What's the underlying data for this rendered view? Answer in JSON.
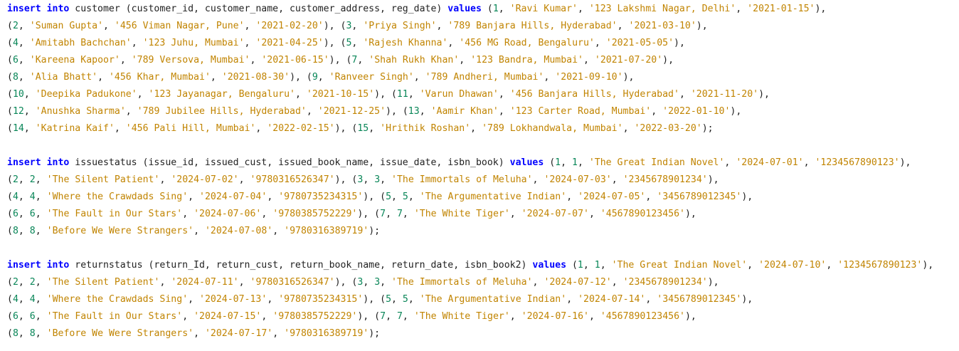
{
  "colors": {
    "background": "#ffffff",
    "keyword": "#0000ff",
    "number": "#098658",
    "string": "#c18401",
    "text": "#1f1f1f"
  },
  "lines": [
    [
      {
        "t": "kw",
        "v": "insert into"
      },
      {
        "t": "plain",
        "v": " customer (customer_id, customer_name, customer_address, reg_date) "
      },
      {
        "t": "kw",
        "v": "values"
      },
      {
        "t": "plain",
        "v": " ("
      },
      {
        "t": "num",
        "v": "1"
      },
      {
        "t": "plain",
        "v": ", "
      },
      {
        "t": "str",
        "v": "'Ravi Kumar'"
      },
      {
        "t": "plain",
        "v": ", "
      },
      {
        "t": "str",
        "v": "'123 Lakshmi Nagar, Delhi'"
      },
      {
        "t": "plain",
        "v": ", "
      },
      {
        "t": "str",
        "v": "'2021-01-15'"
      },
      {
        "t": "plain",
        "v": "),"
      }
    ],
    [
      {
        "t": "plain",
        "v": "("
      },
      {
        "t": "num",
        "v": "2"
      },
      {
        "t": "plain",
        "v": ", "
      },
      {
        "t": "str",
        "v": "'Suman Gupta'"
      },
      {
        "t": "plain",
        "v": ", "
      },
      {
        "t": "str",
        "v": "'456 Viman Nagar, Pune'"
      },
      {
        "t": "plain",
        "v": ", "
      },
      {
        "t": "str",
        "v": "'2021-02-20'"
      },
      {
        "t": "plain",
        "v": "), ("
      },
      {
        "t": "num",
        "v": "3"
      },
      {
        "t": "plain",
        "v": ", "
      },
      {
        "t": "str",
        "v": "'Priya Singh'"
      },
      {
        "t": "plain",
        "v": ", "
      },
      {
        "t": "str",
        "v": "'789 Banjara Hills, Hyderabad'"
      },
      {
        "t": "plain",
        "v": ", "
      },
      {
        "t": "str",
        "v": "'2021-03-10'"
      },
      {
        "t": "plain",
        "v": "),"
      }
    ],
    [
      {
        "t": "plain",
        "v": "("
      },
      {
        "t": "num",
        "v": "4"
      },
      {
        "t": "plain",
        "v": ", "
      },
      {
        "t": "str",
        "v": "'Amitabh Bachchan'"
      },
      {
        "t": "plain",
        "v": ", "
      },
      {
        "t": "str",
        "v": "'123 Juhu, Mumbai'"
      },
      {
        "t": "plain",
        "v": ", "
      },
      {
        "t": "str",
        "v": "'2021-04-25'"
      },
      {
        "t": "plain",
        "v": "), ("
      },
      {
        "t": "num",
        "v": "5"
      },
      {
        "t": "plain",
        "v": ", "
      },
      {
        "t": "str",
        "v": "'Rajesh Khanna'"
      },
      {
        "t": "plain",
        "v": ", "
      },
      {
        "t": "str",
        "v": "'456 MG Road, Bengaluru'"
      },
      {
        "t": "plain",
        "v": ", "
      },
      {
        "t": "str",
        "v": "'2021-05-05'"
      },
      {
        "t": "plain",
        "v": "),"
      }
    ],
    [
      {
        "t": "plain",
        "v": "("
      },
      {
        "t": "num",
        "v": "6"
      },
      {
        "t": "plain",
        "v": ", "
      },
      {
        "t": "str",
        "v": "'Kareena Kapoor'"
      },
      {
        "t": "plain",
        "v": ", "
      },
      {
        "t": "str",
        "v": "'789 Versova, Mumbai'"
      },
      {
        "t": "plain",
        "v": ", "
      },
      {
        "t": "str",
        "v": "'2021-06-15'"
      },
      {
        "t": "plain",
        "v": "), ("
      },
      {
        "t": "num",
        "v": "7"
      },
      {
        "t": "plain",
        "v": ", "
      },
      {
        "t": "str",
        "v": "'Shah Rukh Khan'"
      },
      {
        "t": "plain",
        "v": ", "
      },
      {
        "t": "str",
        "v": "'123 Bandra, Mumbai'"
      },
      {
        "t": "plain",
        "v": ", "
      },
      {
        "t": "str",
        "v": "'2021-07-20'"
      },
      {
        "t": "plain",
        "v": "),"
      }
    ],
    [
      {
        "t": "plain",
        "v": "("
      },
      {
        "t": "num",
        "v": "8"
      },
      {
        "t": "plain",
        "v": ", "
      },
      {
        "t": "str",
        "v": "'Alia Bhatt'"
      },
      {
        "t": "plain",
        "v": ", "
      },
      {
        "t": "str",
        "v": "'456 Khar, Mumbai'"
      },
      {
        "t": "plain",
        "v": ", "
      },
      {
        "t": "str",
        "v": "'2021-08-30'"
      },
      {
        "t": "plain",
        "v": "), ("
      },
      {
        "t": "num",
        "v": "9"
      },
      {
        "t": "plain",
        "v": ", "
      },
      {
        "t": "str",
        "v": "'Ranveer Singh'"
      },
      {
        "t": "plain",
        "v": ", "
      },
      {
        "t": "str",
        "v": "'789 Andheri, Mumbai'"
      },
      {
        "t": "plain",
        "v": ", "
      },
      {
        "t": "str",
        "v": "'2021-09-10'"
      },
      {
        "t": "plain",
        "v": "),"
      }
    ],
    [
      {
        "t": "plain",
        "v": "("
      },
      {
        "t": "num",
        "v": "10"
      },
      {
        "t": "plain",
        "v": ", "
      },
      {
        "t": "str",
        "v": "'Deepika Padukone'"
      },
      {
        "t": "plain",
        "v": ", "
      },
      {
        "t": "str",
        "v": "'123 Jayanagar, Bengaluru'"
      },
      {
        "t": "plain",
        "v": ", "
      },
      {
        "t": "str",
        "v": "'2021-10-15'"
      },
      {
        "t": "plain",
        "v": "), ("
      },
      {
        "t": "num",
        "v": "11"
      },
      {
        "t": "plain",
        "v": ", "
      },
      {
        "t": "str",
        "v": "'Varun Dhawan'"
      },
      {
        "t": "plain",
        "v": ", "
      },
      {
        "t": "str",
        "v": "'456 Banjara Hills, Hyderabad'"
      },
      {
        "t": "plain",
        "v": ", "
      },
      {
        "t": "str",
        "v": "'2021-11-20'"
      },
      {
        "t": "plain",
        "v": "),"
      }
    ],
    [
      {
        "t": "plain",
        "v": "("
      },
      {
        "t": "num",
        "v": "12"
      },
      {
        "t": "plain",
        "v": ", "
      },
      {
        "t": "str",
        "v": "'Anushka Sharma'"
      },
      {
        "t": "plain",
        "v": ", "
      },
      {
        "t": "str",
        "v": "'789 Jubilee Hills, Hyderabad'"
      },
      {
        "t": "plain",
        "v": ", "
      },
      {
        "t": "str",
        "v": "'2021-12-25'"
      },
      {
        "t": "plain",
        "v": "), ("
      },
      {
        "t": "num",
        "v": "13"
      },
      {
        "t": "plain",
        "v": ", "
      },
      {
        "t": "str",
        "v": "'Aamir Khan'"
      },
      {
        "t": "plain",
        "v": ", "
      },
      {
        "t": "str",
        "v": "'123 Carter Road, Mumbai'"
      },
      {
        "t": "plain",
        "v": ", "
      },
      {
        "t": "str",
        "v": "'2022-01-10'"
      },
      {
        "t": "plain",
        "v": "),"
      }
    ],
    [
      {
        "t": "plain",
        "v": "("
      },
      {
        "t": "num",
        "v": "14"
      },
      {
        "t": "plain",
        "v": ", "
      },
      {
        "t": "str",
        "v": "'Katrina Kaif'"
      },
      {
        "t": "plain",
        "v": ", "
      },
      {
        "t": "str",
        "v": "'456 Pali Hill, Mumbai'"
      },
      {
        "t": "plain",
        "v": ", "
      },
      {
        "t": "str",
        "v": "'2022-02-15'"
      },
      {
        "t": "plain",
        "v": "), ("
      },
      {
        "t": "num",
        "v": "15"
      },
      {
        "t": "plain",
        "v": ", "
      },
      {
        "t": "str",
        "v": "'Hrithik Roshan'"
      },
      {
        "t": "plain",
        "v": ", "
      },
      {
        "t": "str",
        "v": "'789 Lokhandwala, Mumbai'"
      },
      {
        "t": "plain",
        "v": ", "
      },
      {
        "t": "str",
        "v": "'2022-03-20'"
      },
      {
        "t": "plain",
        "v": ");"
      }
    ],
    [],
    [
      {
        "t": "kw",
        "v": "insert into"
      },
      {
        "t": "plain",
        "v": " issuestatus (issue_id, issued_cust, issued_book_name, issue_date, isbn_book) "
      },
      {
        "t": "kw",
        "v": "values"
      },
      {
        "t": "plain",
        "v": " ("
      },
      {
        "t": "num",
        "v": "1"
      },
      {
        "t": "plain",
        "v": ", "
      },
      {
        "t": "num",
        "v": "1"
      },
      {
        "t": "plain",
        "v": ", "
      },
      {
        "t": "str",
        "v": "'The Great Indian Novel'"
      },
      {
        "t": "plain",
        "v": ", "
      },
      {
        "t": "str",
        "v": "'2024-07-01'"
      },
      {
        "t": "plain",
        "v": ", "
      },
      {
        "t": "str",
        "v": "'1234567890123'"
      },
      {
        "t": "plain",
        "v": "),"
      }
    ],
    [
      {
        "t": "plain",
        "v": "("
      },
      {
        "t": "num",
        "v": "2"
      },
      {
        "t": "plain",
        "v": ", "
      },
      {
        "t": "num",
        "v": "2"
      },
      {
        "t": "plain",
        "v": ", "
      },
      {
        "t": "str",
        "v": "'The Silent Patient'"
      },
      {
        "t": "plain",
        "v": ", "
      },
      {
        "t": "str",
        "v": "'2024-07-02'"
      },
      {
        "t": "plain",
        "v": ", "
      },
      {
        "t": "str",
        "v": "'9780316526347'"
      },
      {
        "t": "plain",
        "v": "), ("
      },
      {
        "t": "num",
        "v": "3"
      },
      {
        "t": "plain",
        "v": ", "
      },
      {
        "t": "num",
        "v": "3"
      },
      {
        "t": "plain",
        "v": ", "
      },
      {
        "t": "str",
        "v": "'The Immortals of Meluha'"
      },
      {
        "t": "plain",
        "v": ", "
      },
      {
        "t": "str",
        "v": "'2024-07-03'"
      },
      {
        "t": "plain",
        "v": ", "
      },
      {
        "t": "str",
        "v": "'2345678901234'"
      },
      {
        "t": "plain",
        "v": "),"
      }
    ],
    [
      {
        "t": "plain",
        "v": "("
      },
      {
        "t": "num",
        "v": "4"
      },
      {
        "t": "plain",
        "v": ", "
      },
      {
        "t": "num",
        "v": "4"
      },
      {
        "t": "plain",
        "v": ", "
      },
      {
        "t": "str",
        "v": "'Where the Crawdads Sing'"
      },
      {
        "t": "plain",
        "v": ", "
      },
      {
        "t": "str",
        "v": "'2024-07-04'"
      },
      {
        "t": "plain",
        "v": ", "
      },
      {
        "t": "str",
        "v": "'9780735234315'"
      },
      {
        "t": "plain",
        "v": "), ("
      },
      {
        "t": "num",
        "v": "5"
      },
      {
        "t": "plain",
        "v": ", "
      },
      {
        "t": "num",
        "v": "5"
      },
      {
        "t": "plain",
        "v": ", "
      },
      {
        "t": "str",
        "v": "'The Argumentative Indian'"
      },
      {
        "t": "plain",
        "v": ", "
      },
      {
        "t": "str",
        "v": "'2024-07-05'"
      },
      {
        "t": "plain",
        "v": ", "
      },
      {
        "t": "str",
        "v": "'3456789012345'"
      },
      {
        "t": "plain",
        "v": "),"
      }
    ],
    [
      {
        "t": "plain",
        "v": "("
      },
      {
        "t": "num",
        "v": "6"
      },
      {
        "t": "plain",
        "v": ", "
      },
      {
        "t": "num",
        "v": "6"
      },
      {
        "t": "plain",
        "v": ", "
      },
      {
        "t": "str",
        "v": "'The Fault in Our Stars'"
      },
      {
        "t": "plain",
        "v": ", "
      },
      {
        "t": "str",
        "v": "'2024-07-06'"
      },
      {
        "t": "plain",
        "v": ", "
      },
      {
        "t": "str",
        "v": "'9780385752229'"
      },
      {
        "t": "plain",
        "v": "), ("
      },
      {
        "t": "num",
        "v": "7"
      },
      {
        "t": "plain",
        "v": ", "
      },
      {
        "t": "num",
        "v": "7"
      },
      {
        "t": "plain",
        "v": ", "
      },
      {
        "t": "str",
        "v": "'The White Tiger'"
      },
      {
        "t": "plain",
        "v": ", "
      },
      {
        "t": "str",
        "v": "'2024-07-07'"
      },
      {
        "t": "plain",
        "v": ", "
      },
      {
        "t": "str",
        "v": "'4567890123456'"
      },
      {
        "t": "plain",
        "v": "),"
      }
    ],
    [
      {
        "t": "plain",
        "v": "("
      },
      {
        "t": "num",
        "v": "8"
      },
      {
        "t": "plain",
        "v": ", "
      },
      {
        "t": "num",
        "v": "8"
      },
      {
        "t": "plain",
        "v": ", "
      },
      {
        "t": "str",
        "v": "'Before We Were Strangers'"
      },
      {
        "t": "plain",
        "v": ", "
      },
      {
        "t": "str",
        "v": "'2024-07-08'"
      },
      {
        "t": "plain",
        "v": ", "
      },
      {
        "t": "str",
        "v": "'9780316389719'"
      },
      {
        "t": "plain",
        "v": ");"
      }
    ],
    [],
    [
      {
        "t": "kw",
        "v": "insert into"
      },
      {
        "t": "plain",
        "v": " returnstatus (return_Id, return_cust, return_book_name, return_date, isbn_book2) "
      },
      {
        "t": "kw",
        "v": "values"
      },
      {
        "t": "plain",
        "v": " ("
      },
      {
        "t": "num",
        "v": "1"
      },
      {
        "t": "plain",
        "v": ", "
      },
      {
        "t": "num",
        "v": "1"
      },
      {
        "t": "plain",
        "v": ", "
      },
      {
        "t": "str",
        "v": "'The Great Indian Novel'"
      },
      {
        "t": "plain",
        "v": ", "
      },
      {
        "t": "str",
        "v": "'2024-07-10'"
      },
      {
        "t": "plain",
        "v": ", "
      },
      {
        "t": "str",
        "v": "'1234567890123'"
      },
      {
        "t": "plain",
        "v": "),"
      }
    ],
    [
      {
        "t": "plain",
        "v": "("
      },
      {
        "t": "num",
        "v": "2"
      },
      {
        "t": "plain",
        "v": ", "
      },
      {
        "t": "num",
        "v": "2"
      },
      {
        "t": "plain",
        "v": ", "
      },
      {
        "t": "str",
        "v": "'The Silent Patient'"
      },
      {
        "t": "plain",
        "v": ", "
      },
      {
        "t": "str",
        "v": "'2024-07-11'"
      },
      {
        "t": "plain",
        "v": ", "
      },
      {
        "t": "str",
        "v": "'9780316526347'"
      },
      {
        "t": "plain",
        "v": "), ("
      },
      {
        "t": "num",
        "v": "3"
      },
      {
        "t": "plain",
        "v": ", "
      },
      {
        "t": "num",
        "v": "3"
      },
      {
        "t": "plain",
        "v": ", "
      },
      {
        "t": "str",
        "v": "'The Immortals of Meluha'"
      },
      {
        "t": "plain",
        "v": ", "
      },
      {
        "t": "str",
        "v": "'2024-07-12'"
      },
      {
        "t": "plain",
        "v": ", "
      },
      {
        "t": "str",
        "v": "'2345678901234'"
      },
      {
        "t": "plain",
        "v": "),"
      }
    ],
    [
      {
        "t": "plain",
        "v": "("
      },
      {
        "t": "num",
        "v": "4"
      },
      {
        "t": "plain",
        "v": ", "
      },
      {
        "t": "num",
        "v": "4"
      },
      {
        "t": "plain",
        "v": ", "
      },
      {
        "t": "str",
        "v": "'Where the Crawdads Sing'"
      },
      {
        "t": "plain",
        "v": ", "
      },
      {
        "t": "str",
        "v": "'2024-07-13'"
      },
      {
        "t": "plain",
        "v": ", "
      },
      {
        "t": "str",
        "v": "'9780735234315'"
      },
      {
        "t": "plain",
        "v": "), ("
      },
      {
        "t": "num",
        "v": "5"
      },
      {
        "t": "plain",
        "v": ", "
      },
      {
        "t": "num",
        "v": "5"
      },
      {
        "t": "plain",
        "v": ", "
      },
      {
        "t": "str",
        "v": "'The Argumentative Indian'"
      },
      {
        "t": "plain",
        "v": ", "
      },
      {
        "t": "str",
        "v": "'2024-07-14'"
      },
      {
        "t": "plain",
        "v": ", "
      },
      {
        "t": "str",
        "v": "'3456789012345'"
      },
      {
        "t": "plain",
        "v": "),"
      }
    ],
    [
      {
        "t": "plain",
        "v": "("
      },
      {
        "t": "num",
        "v": "6"
      },
      {
        "t": "plain",
        "v": ", "
      },
      {
        "t": "num",
        "v": "6"
      },
      {
        "t": "plain",
        "v": ", "
      },
      {
        "t": "str",
        "v": "'The Fault in Our Stars'"
      },
      {
        "t": "plain",
        "v": ", "
      },
      {
        "t": "str",
        "v": "'2024-07-15'"
      },
      {
        "t": "plain",
        "v": ", "
      },
      {
        "t": "str",
        "v": "'9780385752229'"
      },
      {
        "t": "plain",
        "v": "), ("
      },
      {
        "t": "num",
        "v": "7"
      },
      {
        "t": "plain",
        "v": ", "
      },
      {
        "t": "num",
        "v": "7"
      },
      {
        "t": "plain",
        "v": ", "
      },
      {
        "t": "str",
        "v": "'The White Tiger'"
      },
      {
        "t": "plain",
        "v": ", "
      },
      {
        "t": "str",
        "v": "'2024-07-16'"
      },
      {
        "t": "plain",
        "v": ", "
      },
      {
        "t": "str",
        "v": "'4567890123456'"
      },
      {
        "t": "plain",
        "v": "),"
      }
    ],
    [
      {
        "t": "plain",
        "v": "("
      },
      {
        "t": "num",
        "v": "8"
      },
      {
        "t": "plain",
        "v": ", "
      },
      {
        "t": "num",
        "v": "8"
      },
      {
        "t": "plain",
        "v": ", "
      },
      {
        "t": "str",
        "v": "'Before We Were Strangers'"
      },
      {
        "t": "plain",
        "v": ", "
      },
      {
        "t": "str",
        "v": "'2024-07-17'"
      },
      {
        "t": "plain",
        "v": ", "
      },
      {
        "t": "str",
        "v": "'9780316389719'"
      },
      {
        "t": "plain",
        "v": ");"
      }
    ]
  ]
}
